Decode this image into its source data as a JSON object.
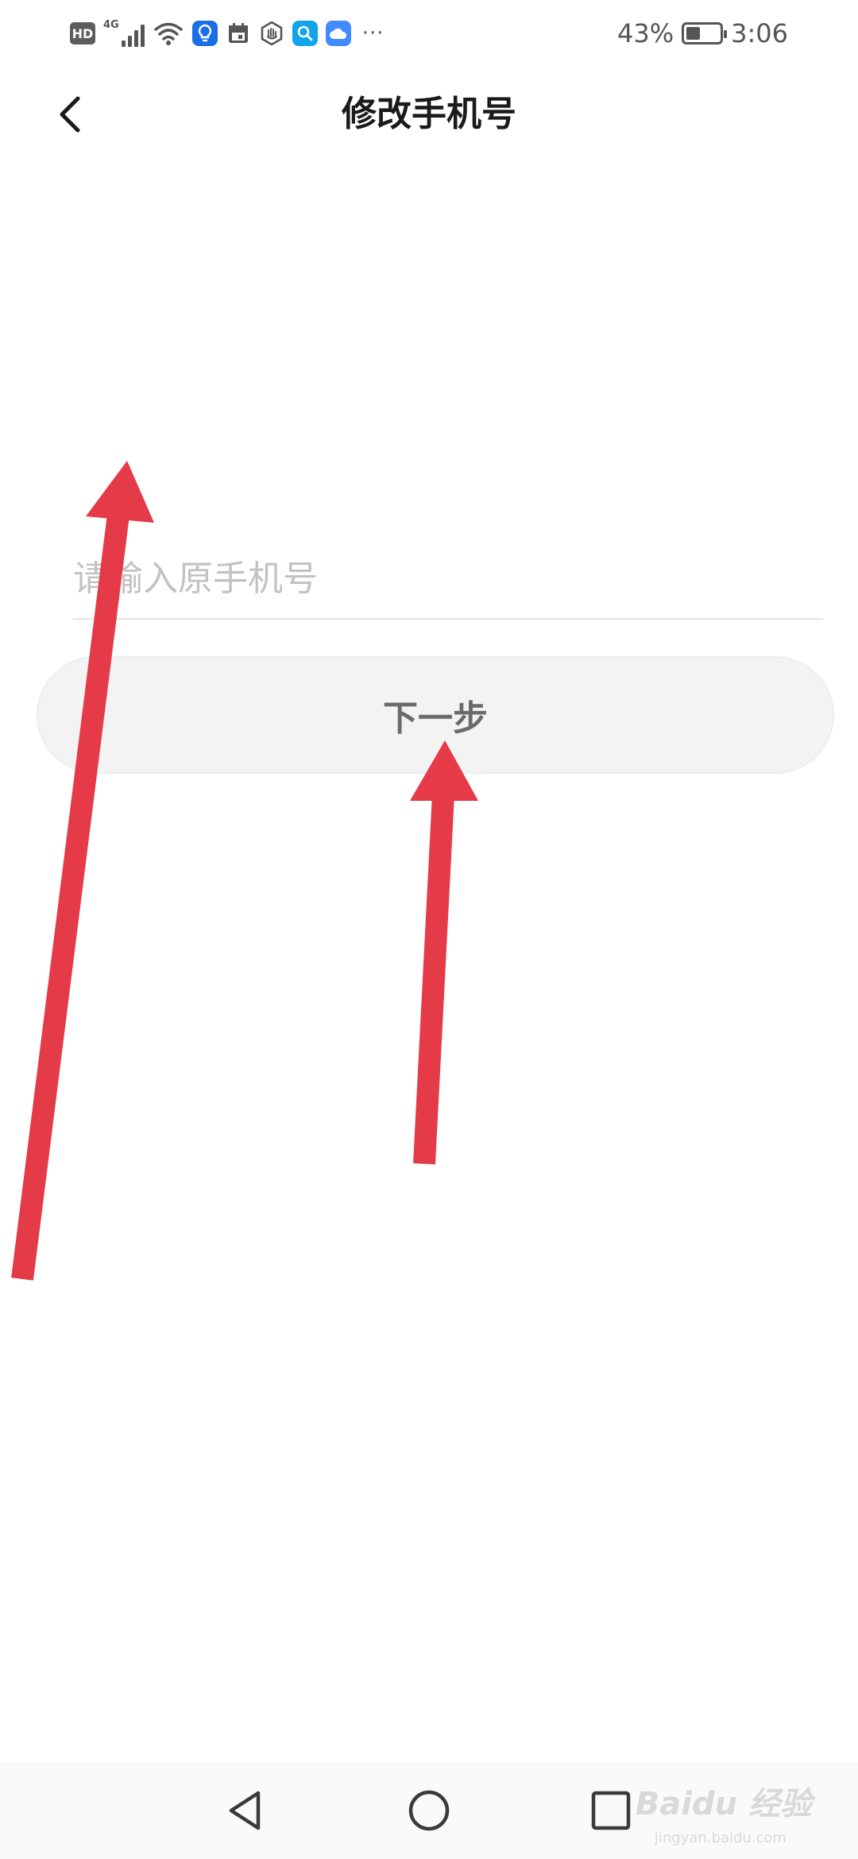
{
  "status_bar": {
    "hd_label": "HD",
    "network_label": "4G",
    "more_dots": "···",
    "battery_percent_text": "43%",
    "battery_level": 0.43,
    "time": "3:06",
    "app_icons": [
      "lightbulb-app-icon",
      "calendar-app-icon",
      "hand-app-icon",
      "search-app-icon",
      "cloud-app-icon"
    ]
  },
  "header": {
    "title": "修改手机号",
    "back_icon": "chevron-left-icon"
  },
  "form": {
    "phone_placeholder": "请输入原手机号",
    "phone_value": "",
    "next_label": "下一步"
  },
  "annotation": {
    "arrow_color": "#e53a48"
  },
  "nav_bar": {
    "back_icon": "triangle-back-icon",
    "home_icon": "circle-home-icon",
    "recents_icon": "square-recents-icon"
  },
  "watermark": {
    "brand": "Baidu 经验",
    "url": "jingyan.baidu.com"
  },
  "colors": {
    "background": "#ffffff",
    "button_bg": "#f3f3f3",
    "button_text": "#6a6a6a",
    "placeholder": "#c2c2c2"
  }
}
